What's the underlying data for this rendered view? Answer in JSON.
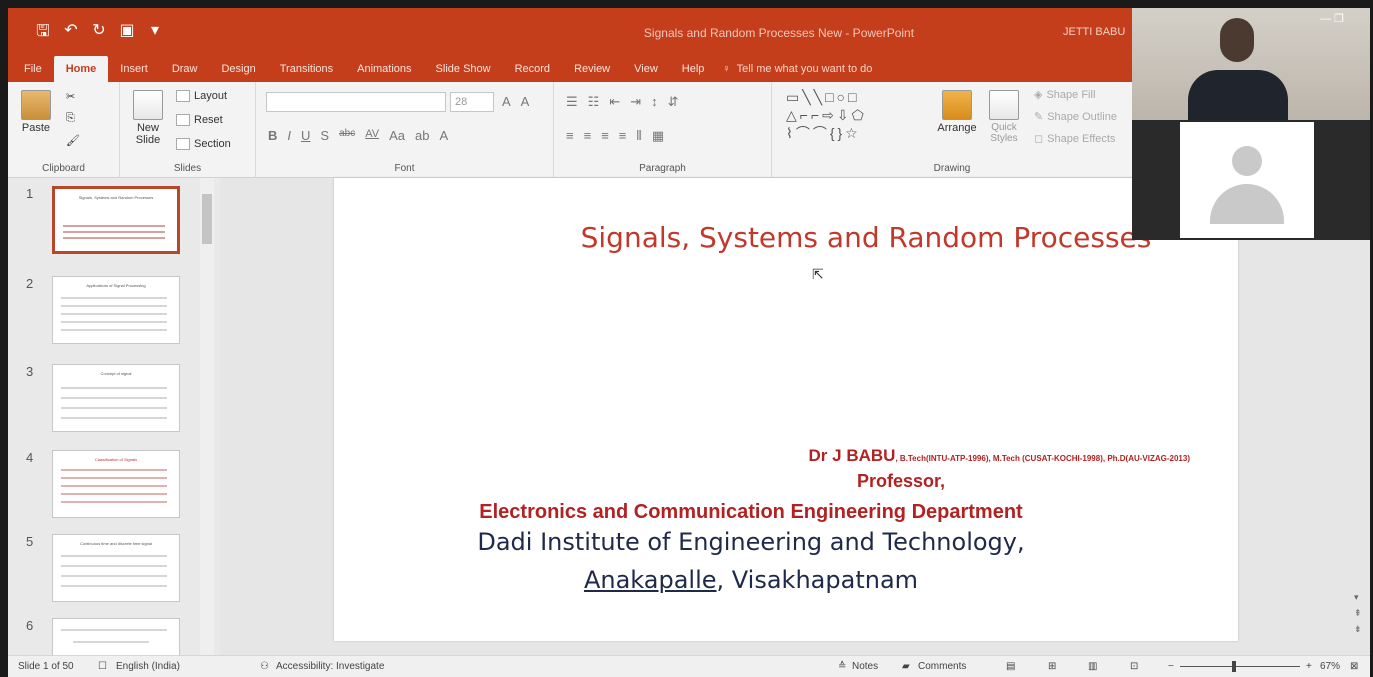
{
  "window": {
    "title": "Signals and Random Processes New  -  PowerPoint",
    "user": "JETTI BABU",
    "qat_icons": [
      "save-icon",
      "undo-icon",
      "redo-icon",
      "present-icon",
      "customize-icon"
    ]
  },
  "tabs": [
    "File",
    "Home",
    "Insert",
    "Draw",
    "Design",
    "Transitions",
    "Animations",
    "Slide Show",
    "Record",
    "Review",
    "View",
    "Help"
  ],
  "active_tab": "Home",
  "tell_me": "Tell me what you want to do",
  "ribbon": {
    "clipboard": {
      "label": "Clipboard",
      "paste": "Paste"
    },
    "slides": {
      "label": "Slides",
      "new_slide": "New Slide",
      "layout": "Layout",
      "reset": "Reset",
      "section": "Section"
    },
    "font": {
      "label": "Font",
      "size": "28",
      "bold": "B",
      "italic": "I",
      "underline": "U",
      "shadow": "S",
      "strike": "abc",
      "spacing": "AV",
      "case": "Aa",
      "grow": "A",
      "shrink": "A"
    },
    "paragraph": {
      "label": "Paragraph"
    },
    "drawing": {
      "label": "Drawing",
      "arrange": "Arrange",
      "quick_styles": "Quick Styles",
      "shape_fill": "Shape Fill",
      "shape_outline": "Shape Outline",
      "shape_effects": "Shape Effects"
    }
  },
  "thumbnails": [
    {
      "num": "1",
      "title": "Signals, Systems and Random Processes",
      "selected": true
    },
    {
      "num": "2",
      "title": "Applications of Signal Processing",
      "selected": false
    },
    {
      "num": "3",
      "title": "Concept of signal",
      "selected": false
    },
    {
      "num": "4",
      "title": "Classification of Signals",
      "selected": false
    },
    {
      "num": "5",
      "title": "Continuous time and discrete time signal",
      "selected": false
    },
    {
      "num": "6",
      "title": "",
      "selected": false
    }
  ],
  "slide": {
    "title": "Signals, Systems and Random Processes",
    "author": "Dr J BABU",
    "degrees": ", B.Tech(INTU-ATP-1996), M.Tech (CUSAT-KOCHI-1998), Ph.D(AU-VIZAG-2013)",
    "position": "Professor,",
    "department": "Electronics and Communication Engineering Department",
    "institute": "Dadi Institute of Engineering and Technology,",
    "location_1": "Anakapalle",
    "location_2": ", Visakhapatnam"
  },
  "status": {
    "slide_info": "Slide 1 of 50",
    "language": "English (India)",
    "accessibility": "Accessibility: Investigate",
    "notes": "Notes",
    "comments": "Comments",
    "zoom": "67%",
    "zoom_fraction": 0.45
  }
}
